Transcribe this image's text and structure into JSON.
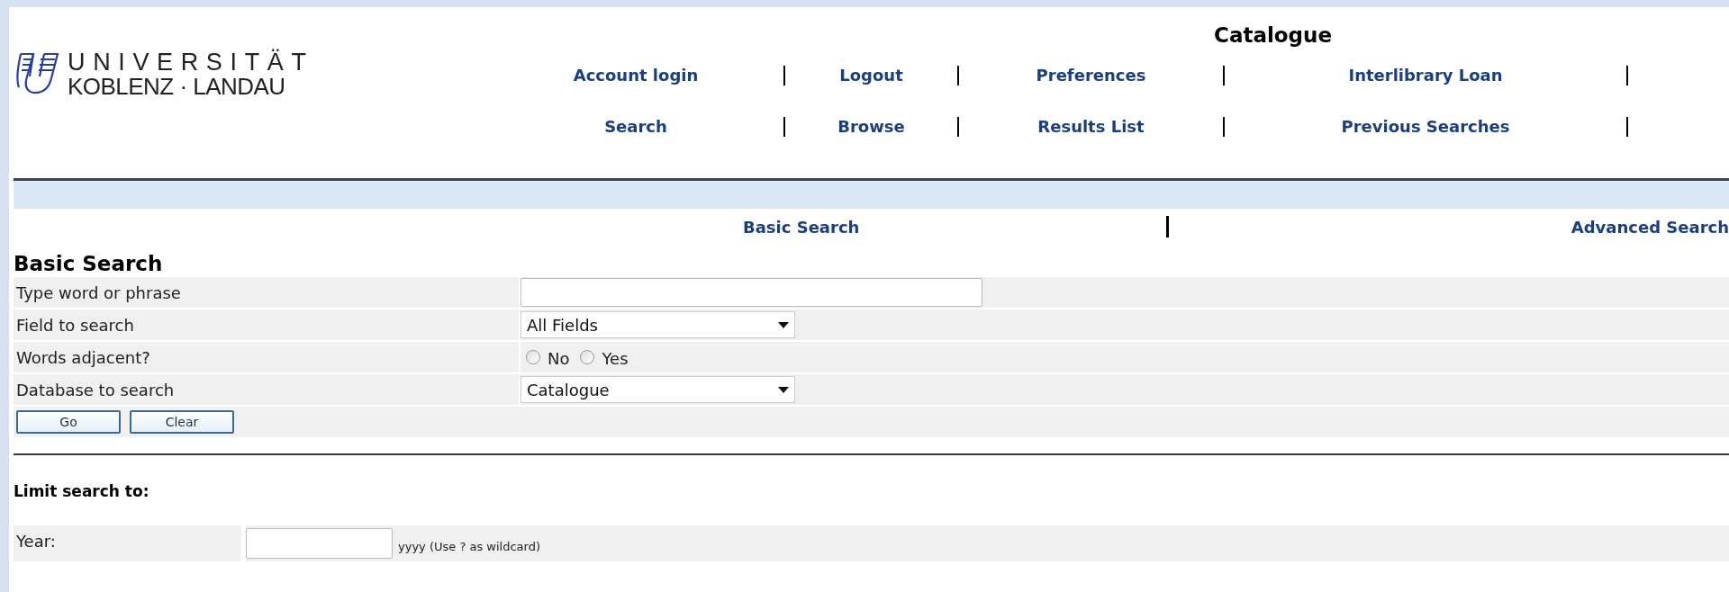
{
  "logo": {
    "line_1": "UNIVERSITÄT",
    "line_2": "KOBLENZ · LANDAU"
  },
  "header": {
    "title": "Catalogue"
  },
  "nav_rows": [
    [
      "Account login",
      "Logout",
      "Preferences",
      "Interlibrary Loan"
    ],
    [
      "Search",
      "Browse",
      "Results List",
      "Previous Searches"
    ]
  ],
  "search_tabs": [
    "Basic Search",
    "Advanced Search"
  ],
  "basic_search": {
    "heading": "Basic Search",
    "rows": [
      {
        "kind": "text",
        "label": "Type word or phrase"
      },
      {
        "kind": "select",
        "label": "Field to search",
        "value": "All Fields"
      },
      {
        "kind": "radio",
        "label": "Words adjacent?",
        "options": [
          {
            "label": "No",
            "checked": false
          },
          {
            "label": "Yes",
            "checked": false
          }
        ]
      },
      {
        "kind": "select",
        "label": "Database to search",
        "value": "Catalogue"
      }
    ],
    "buttons": [
      "Go",
      "Clear"
    ]
  },
  "limit": {
    "heading": "Limit search to:",
    "year_label": "Year:",
    "year_hint": "yyyy (Use ? as wildcard)"
  }
}
